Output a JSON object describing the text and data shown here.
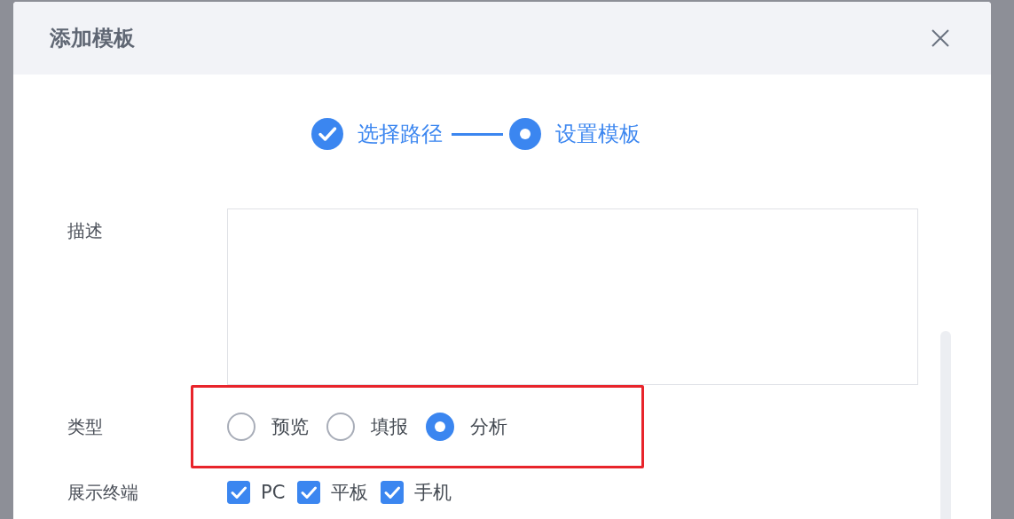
{
  "dialog": {
    "title": "添加模板"
  },
  "steps": [
    {
      "label": "选择路径",
      "completed": true
    },
    {
      "label": "设置模板",
      "completed": false
    }
  ],
  "form": {
    "description": {
      "label": "描述"
    },
    "type": {
      "label": "类型",
      "highlighted": true,
      "options": [
        {
          "label": "预览",
          "selected": false
        },
        {
          "label": "填报",
          "selected": false
        },
        {
          "label": "分析",
          "selected": true
        }
      ]
    },
    "terminals": {
      "label": "展示终端",
      "options": [
        {
          "label": "PC",
          "checked": true
        },
        {
          "label": "平板",
          "checked": true
        },
        {
          "label": "手机",
          "checked": true
        }
      ]
    }
  }
}
